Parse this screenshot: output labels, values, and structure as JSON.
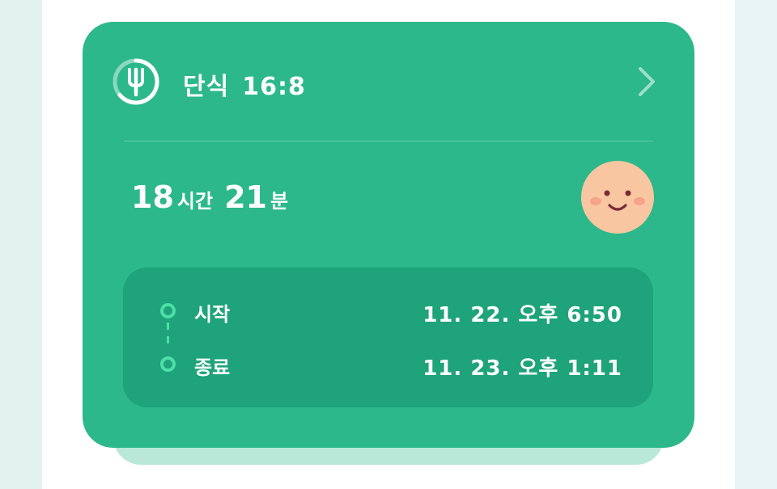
{
  "card": {
    "app_icon": "fork-icon",
    "title": "단식",
    "plan": "16:8",
    "chevron_icon": "chevron-right-icon"
  },
  "elapsed": {
    "hours": "18",
    "hours_unit": "시간",
    "minutes": "21",
    "minutes_unit": "분"
  },
  "mood_icon": "smiley-face-icon",
  "schedule": {
    "start_label": "시작",
    "start_value": "11. 22. 오후 6:50",
    "end_label": "종료",
    "end_value": "11. 23. 오후 1:11"
  },
  "colors": {
    "card": "#2cb88a",
    "panel": "#1ea37a",
    "accent": "#4ce0a6",
    "face": "#f8c6a0"
  }
}
